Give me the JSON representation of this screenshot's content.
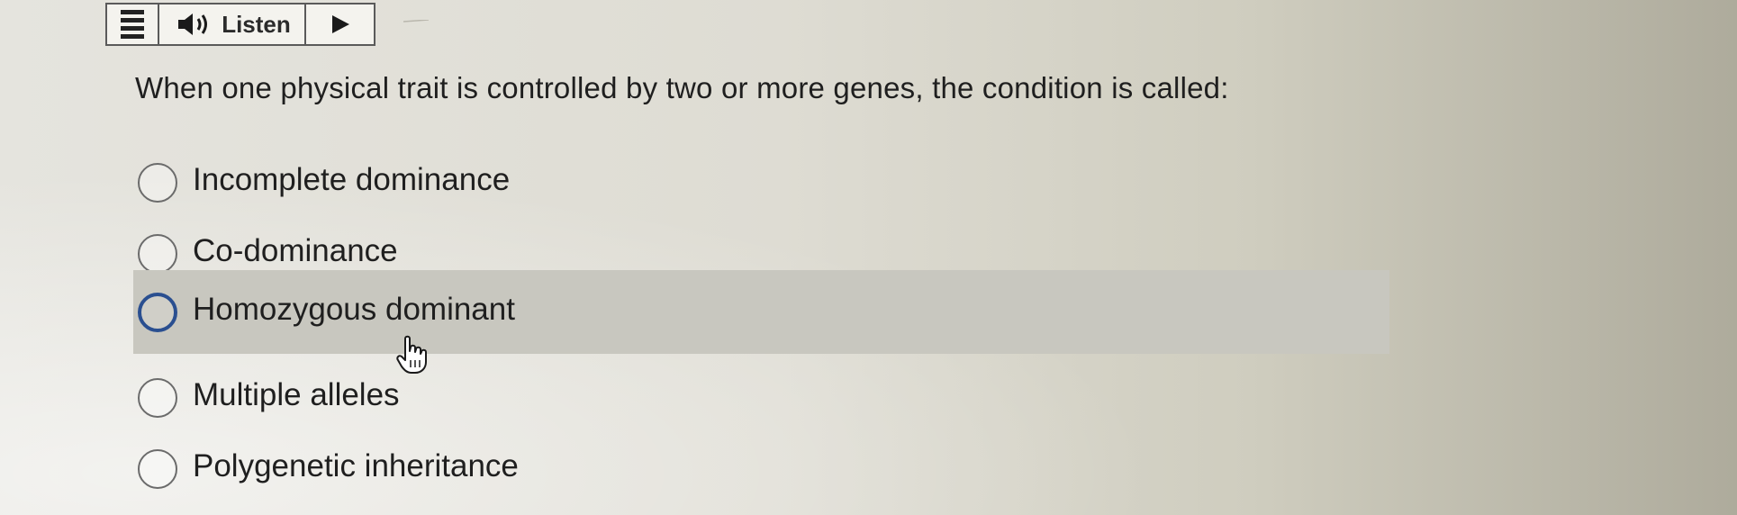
{
  "toolbar": {
    "menu_icon": "hamburger-menu-icon",
    "speaker_icon": "speaker-icon",
    "listen_label": "Listen",
    "play_icon": "play-icon"
  },
  "question": {
    "text": "When one physical trait is controlled by two or more genes, the condition is called:"
  },
  "options": [
    {
      "label": "Incomplete dominance",
      "selected": false
    },
    {
      "label": "Co-dominance",
      "selected": false
    },
    {
      "label": "Homozygous dominant",
      "selected": false,
      "hovered": true
    },
    {
      "label": "Multiple alleles",
      "selected": false
    },
    {
      "label": "Polygenetic inheritance",
      "selected": false
    }
  ],
  "colors": {
    "radio_hover_border": "#2a4f90",
    "hover_background": "#c8c7bf",
    "text": "#1f1f1f"
  },
  "cursor_icon": "hand-pointer-icon"
}
